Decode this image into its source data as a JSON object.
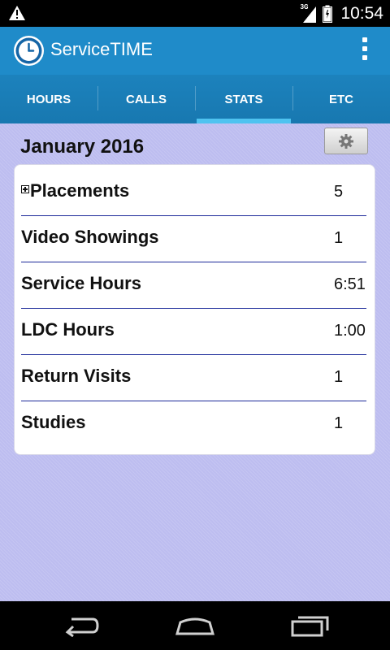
{
  "status_bar": {
    "network": "3G",
    "time": "10:54",
    "icons": [
      "warning-icon",
      "signal-icon",
      "battery-icon"
    ]
  },
  "action_bar": {
    "title": "ServiceTIME",
    "icon": "clock-icon",
    "overflow_icon": "overflow-menu-icon",
    "color": "#1f8bc9"
  },
  "tabs": [
    {
      "label": "HOURS",
      "active": false
    },
    {
      "label": "CALLS",
      "active": false
    },
    {
      "label": "STATS",
      "active": true
    },
    {
      "label": "ETC",
      "active": false
    }
  ],
  "stats": {
    "month": "January 2016",
    "settings_icon": "gear-icon",
    "rows": [
      {
        "label": "Placements",
        "value": "5",
        "expandable": true
      },
      {
        "label": "Video Showings",
        "value": "1"
      },
      {
        "label": "Service Hours",
        "value": "6:51"
      },
      {
        "label": "LDC Hours",
        "value": "1:00"
      },
      {
        "label": "Return Visits",
        "value": "1"
      },
      {
        "label": "Studies",
        "value": "1"
      }
    ]
  },
  "nav_bar": {
    "icons": [
      "back-icon",
      "home-icon",
      "recents-icon"
    ]
  }
}
